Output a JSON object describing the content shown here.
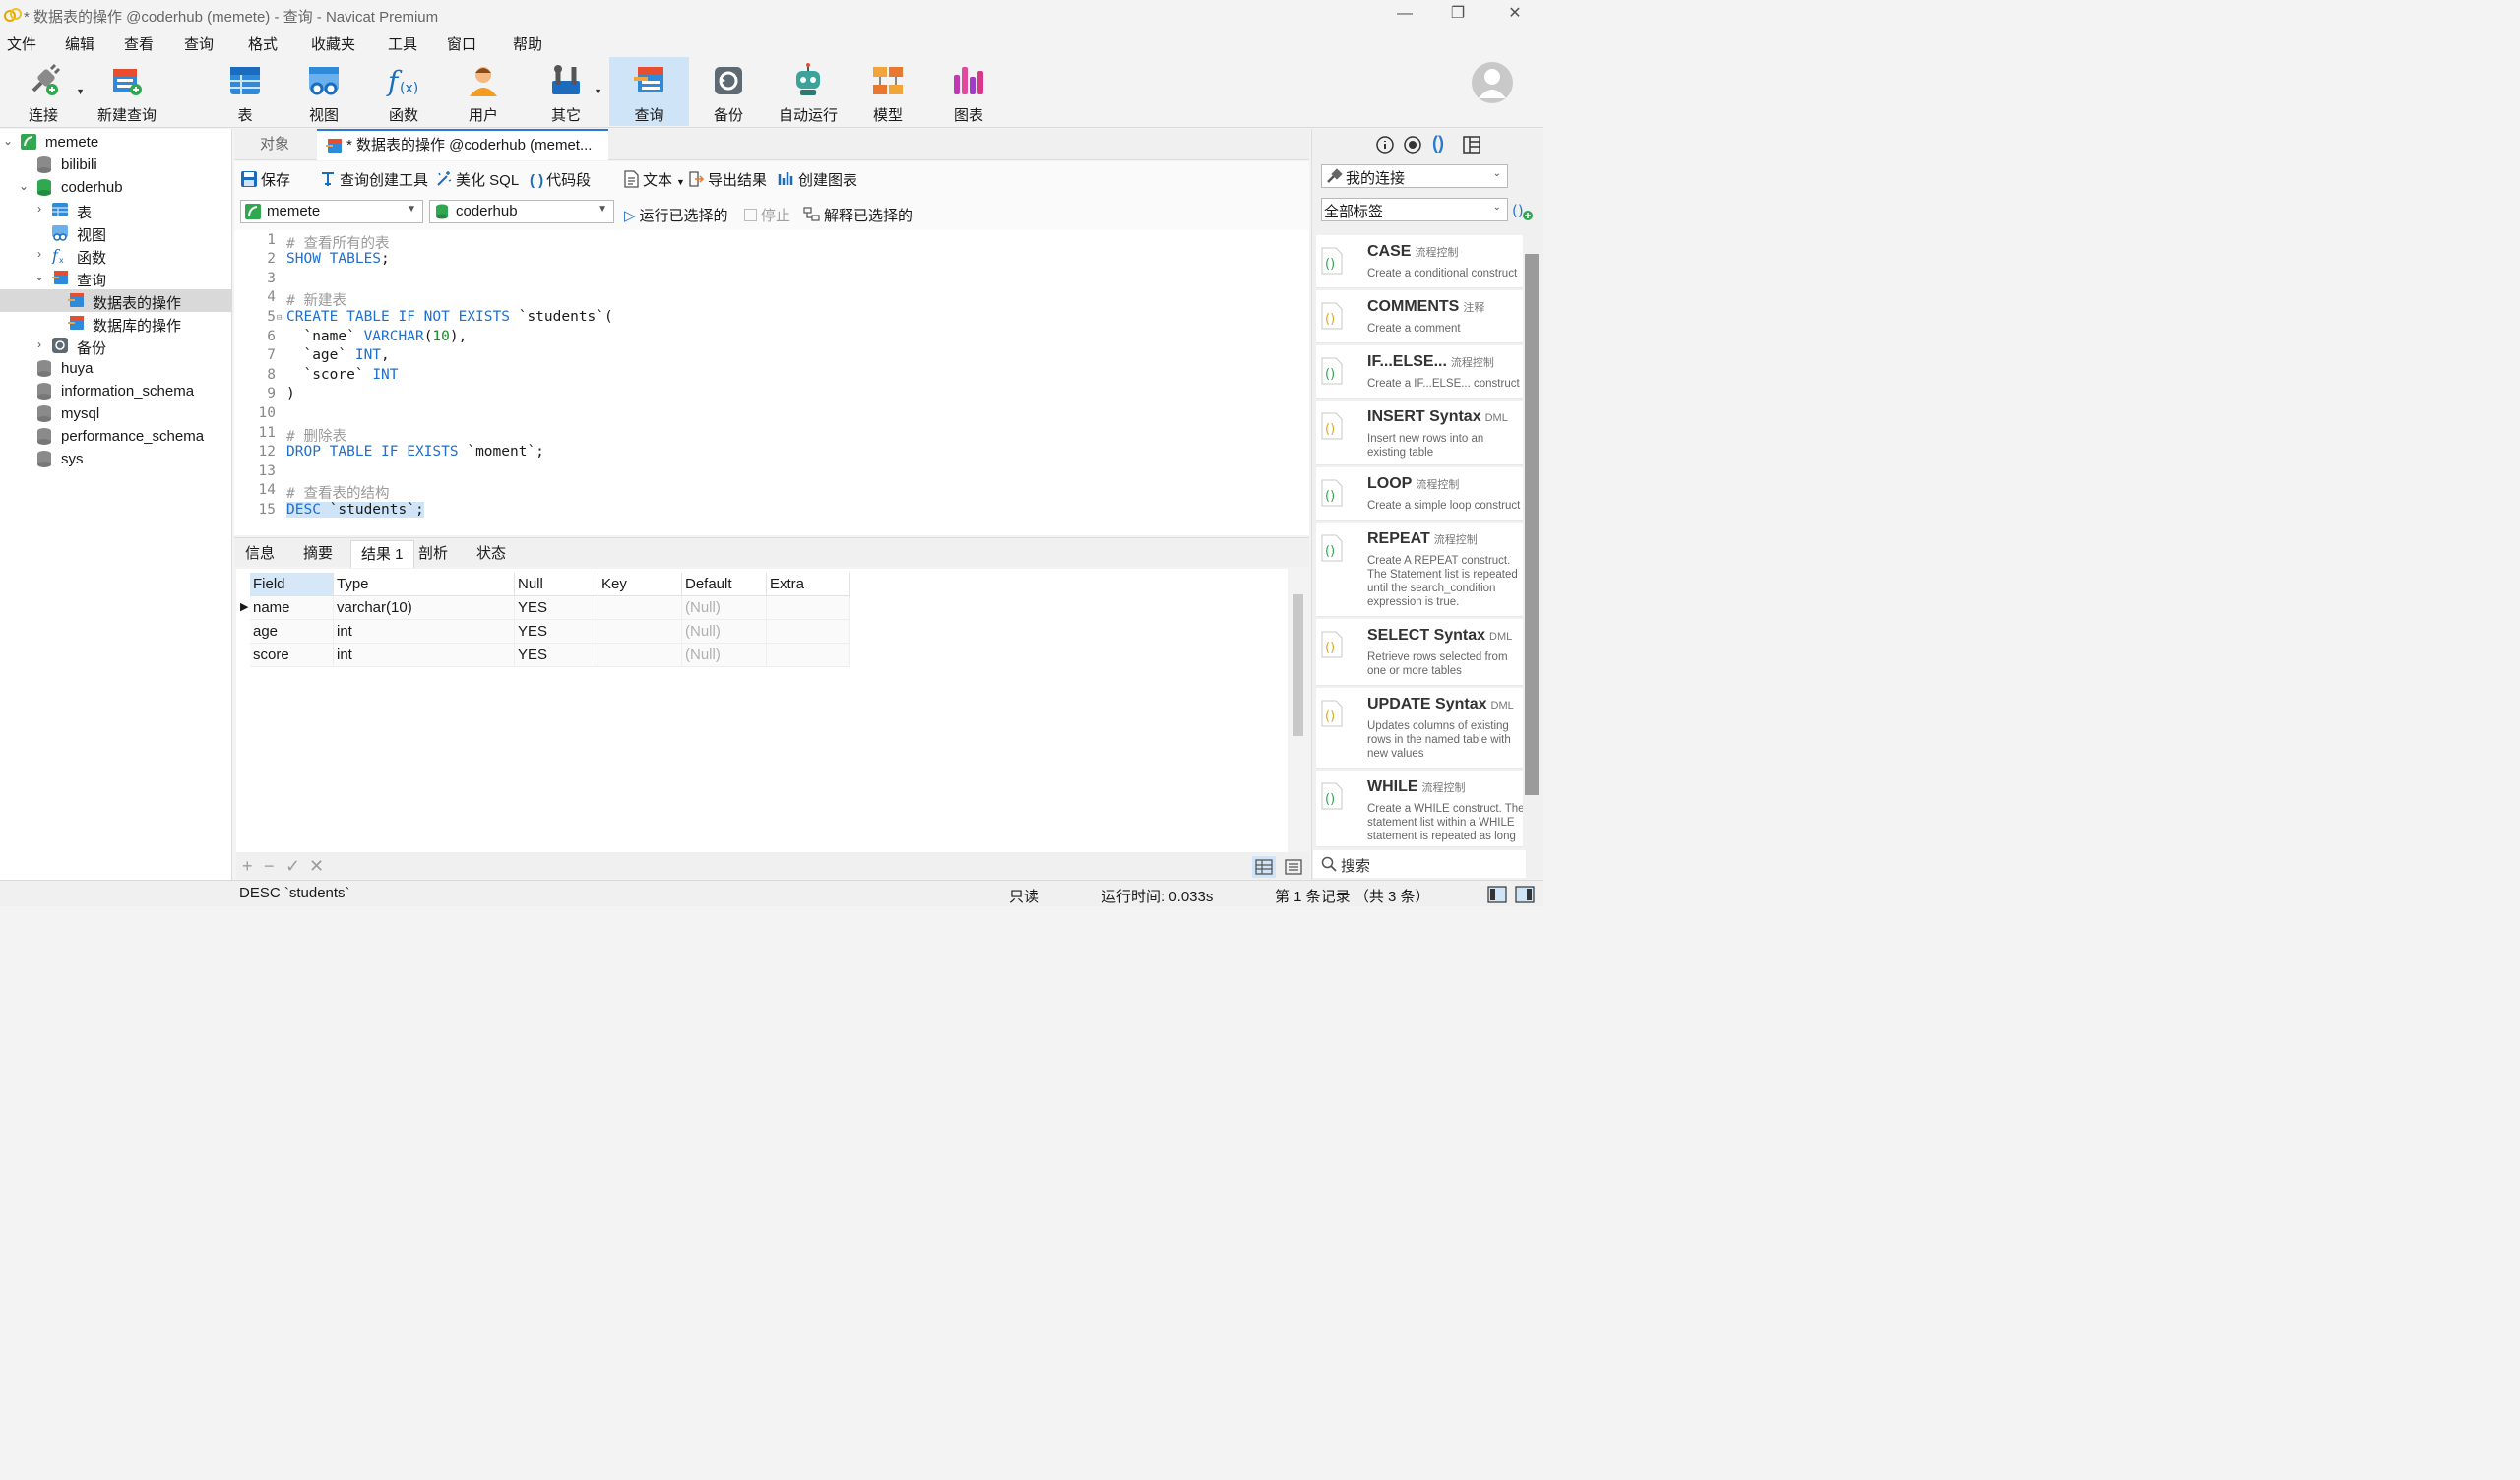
{
  "window": {
    "title": "* 数据表的操作 @coderhub (memete) - 查询 - Navicat Premium",
    "minimize": "—",
    "restore": "❐",
    "close": "✕"
  },
  "menu": [
    "文件",
    "编辑",
    "查看",
    "查询",
    "格式",
    "收藏夹",
    "工具",
    "窗口",
    "帮助"
  ],
  "toolbar": {
    "connect": "连接",
    "new_query": "新建查询",
    "table": "表",
    "view": "视图",
    "function": "函数",
    "user": "用户",
    "other": "其它",
    "query": "查询",
    "backup": "备份",
    "automation": "自动运行",
    "model": "模型",
    "chart": "图表"
  },
  "sidebar": {
    "tree": [
      {
        "label": "memete",
        "level": 0,
        "icon": "connection-icon"
      },
      {
        "label": "bilibili",
        "level": 1,
        "icon": "database-icon"
      },
      {
        "label": "coderhub",
        "level": 1,
        "icon": "database-open-icon"
      },
      {
        "label": "表",
        "level": 2,
        "icon": "table-icon"
      },
      {
        "label": "视图",
        "level": 2,
        "icon": "view-icon"
      },
      {
        "label": "函数",
        "level": 2,
        "icon": "function-icon"
      },
      {
        "label": "查询",
        "level": 2,
        "icon": "query-icon"
      },
      {
        "label": "数据表的操作",
        "level": 3,
        "icon": "query-file-icon",
        "selected": true
      },
      {
        "label": "数据库的操作",
        "level": 3,
        "icon": "query-file-icon"
      },
      {
        "label": "备份",
        "level": 2,
        "icon": "backup-icon"
      },
      {
        "label": "huya",
        "level": 1,
        "icon": "database-icon"
      },
      {
        "label": "information_schema",
        "level": 1,
        "icon": "database-icon"
      },
      {
        "label": "mysql",
        "level": 1,
        "icon": "database-icon"
      },
      {
        "label": "performance_schema",
        "level": 1,
        "icon": "database-icon"
      },
      {
        "label": "sys",
        "level": 1,
        "icon": "database-icon"
      }
    ]
  },
  "tabs": {
    "objects": "对象",
    "active": "* 数据表的操作 @coderhub (memet..."
  },
  "query_toolbar": {
    "save": "保存",
    "builder": "查询创建工具",
    "beautify": "美化 SQL",
    "snippet": "代码段",
    "text": "文本",
    "export": "导出结果",
    "create_chart": "创建图表"
  },
  "selectors": {
    "connection": "memete",
    "database": "coderhub",
    "run_selected": "运行已选择的",
    "stop": "停止",
    "explain": "解释已选择的"
  },
  "editor": {
    "line_numbers": [
      "1",
      "2",
      "3",
      "4",
      "5",
      "6",
      "7",
      "8",
      "9",
      "10",
      "11",
      "12",
      "13",
      "14",
      "15"
    ],
    "l1": "# 查看所有的表",
    "l2_kw": "SHOW TABLES",
    "l2_rest": ";",
    "l4": "# 新建表",
    "l5_kw": "CREATE TABLE IF NOT EXISTS",
    "l5_rest": " `students`(",
    "l6_a": "  `name` ",
    "l6_kw": "VARCHAR",
    "l6_b": "(",
    "l6_num": "10",
    "l6_c": "),",
    "l7_a": "  `age` ",
    "l7_kw": "INT",
    "l7_b": ",",
    "l8_a": "  `score` ",
    "l8_kw": "INT",
    "l9": ")",
    "l11": "# 删除表",
    "l12_kw": "DROP TABLE IF EXISTS",
    "l12_rest": " `moment`;",
    "l14": "# 查看表的结构",
    "l15_kw": "DESC",
    "l15_rest": " `students`;"
  },
  "result_tabs": [
    "信息",
    "摘要",
    "结果 1",
    "剖析",
    "状态"
  ],
  "grid": {
    "columns": [
      "Field",
      "Type",
      "Null",
      "Key",
      "Default",
      "Extra"
    ],
    "rows": [
      [
        "name",
        "varchar(10)",
        "YES",
        "",
        "(Null)",
        ""
      ],
      [
        "age",
        "int",
        "YES",
        "",
        "(Null)",
        ""
      ],
      [
        "score",
        "int",
        "YES",
        "",
        "(Null)",
        ""
      ]
    ]
  },
  "grid_footer": {
    "add": "+",
    "remove": "−",
    "apply": "✓",
    "discard": "✕"
  },
  "right_panel": {
    "connection_combo": "我的连接",
    "tag_combo": "全部标签",
    "search_placeholder": "搜索",
    "snippets": [
      {
        "title": "CASE",
        "tag": "流程控制",
        "desc": "Create a conditional construct"
      },
      {
        "title": "COMMENTS",
        "tag": "注释",
        "desc": "Create a comment"
      },
      {
        "title": "IF...ELSE...",
        "tag": "流程控制",
        "desc": "Create a IF...ELSE... construct"
      },
      {
        "title": "INSERT Syntax",
        "tag": "DML",
        "desc": "Insert new rows into an existing table"
      },
      {
        "title": "LOOP",
        "tag": "流程控制",
        "desc": "Create a simple loop construct"
      },
      {
        "title": "REPEAT",
        "tag": "流程控制",
        "desc": "Create A REPEAT construct. The Statement list is repeated until the search_condition expression is true."
      },
      {
        "title": "SELECT Syntax",
        "tag": "DML",
        "desc": "Retrieve rows selected from one or more tables"
      },
      {
        "title": "UPDATE Syntax",
        "tag": "DML",
        "desc": "Updates columns of existing rows in the named table with new values"
      },
      {
        "title": "WHILE",
        "tag": "流程控制",
        "desc": "Create a WHILE construct. The statement list within a WHILE statement is repeated as long as"
      }
    ]
  },
  "status": {
    "sql": "DESC `students`",
    "readonly": "只读",
    "runtime": "运行时间: 0.033s",
    "records": "第 1 条记录 （共 3 条）"
  },
  "colors": {
    "accent": "#2a7ad4",
    "selection": "#cfe4f7",
    "keyword": "#1f6fd1",
    "comment": "#9a9a9a"
  }
}
